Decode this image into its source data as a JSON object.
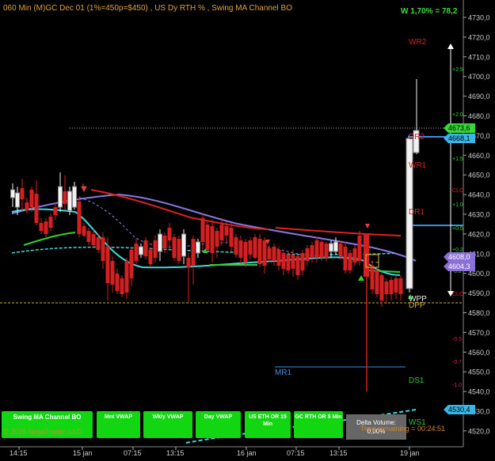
{
  "header": {
    "title": "060 Min  (M)GC Dec 01 (1%=450p=$450) , US Dy RTH % , Swing MA Channel BO",
    "stat": "W 1,70% = 78,2"
  },
  "price_axis": {
    "ticks": [
      "4730,0",
      "4720,0",
      "4710,0",
      "4700,0",
      "4690,0",
      "4680,0",
      "4670,0",
      "4660,0",
      "4650,0",
      "4640,0",
      "4630,0",
      "4620,0",
      "4610,0",
      "4600,0",
      "4590,0",
      "4580,0",
      "4570,0",
      "4560,0",
      "4550,0",
      "4540,0",
      "4530,0",
      "4520,0"
    ],
    "tags": [
      {
        "label": "4673,6",
        "style": "green"
      },
      {
        "label": "4668,1",
        "style": "blue"
      },
      {
        "label": "4608,0",
        "style": "purple"
      },
      {
        "label": "4604,3",
        "style": "purple"
      },
      {
        "label": "4530,4",
        "style": "blue"
      }
    ]
  },
  "time_axis": {
    "ticks": [
      "14:15",
      "15 jan",
      "07:15",
      "13:15",
      "16 jan",
      "07:15",
      "13:15",
      "19 jan"
    ]
  },
  "levels": {
    "wr2": "WR2",
    "wr1": "WR1",
    "dr1": "DR1",
    "dr2": "DR2",
    "wpp": "WPP",
    "dpp": "DPP",
    "mr1": "MR1",
    "ds1": "DS1",
    "ws1": "WS1"
  },
  "pct_scale": {
    "labels": [
      "+2.5",
      "+2.0",
      "+1.5",
      "+1.0",
      "+0.5",
      "+0.2",
      "-0.2",
      "-0.5",
      "-0.7",
      "-1.0"
    ],
    "clo_labels": [
      "CLO",
      "CLO"
    ]
  },
  "panel_buttons": [
    {
      "label": "Swing MA Channel BO"
    },
    {
      "label": "Mnt VWAP"
    },
    {
      "label": "Wkly VWAP"
    },
    {
      "label": "Day VWAP"
    },
    {
      "label": "US ETH OR 15 Min"
    },
    {
      "label": "GC RTH OR 5 Min"
    }
  ],
  "delta": {
    "label": "Delta Volume:",
    "value": "0,00%"
  },
  "footer": {
    "copyright": "© 2026 NinjaTrader, LLC",
    "timer": "Time remaining = 00:24:51"
  },
  "colors": {
    "up": "#f2f2f2",
    "down": "#d42020",
    "ma_purple": "#8878e0",
    "ma_cyan": "#3fd8e0",
    "ma_red": "#e02020",
    "ma_green": "#30d030",
    "pivot_orange": "#d08a30",
    "level_blue": "#3a90e0"
  }
}
